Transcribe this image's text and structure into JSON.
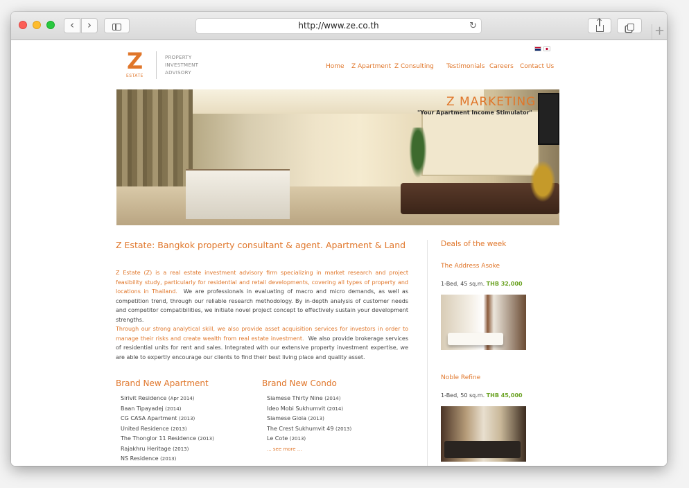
{
  "browser": {
    "url": "http://www.ze.co.th"
  },
  "logo": {
    "letter": "Z",
    "wordmark": "ESTATE",
    "tagline": [
      "PROPERTY",
      "INVESTMENT",
      "ADVISORY"
    ]
  },
  "nav": [
    "Home",
    "Z Apartment",
    "Z Consulting",
    "Testimonials",
    "Careers",
    "Contact Us"
  ],
  "hero": {
    "title": "Z MARKETING",
    "subtitle": "\"Your Apartment Income Stimulator\""
  },
  "main": {
    "heading": "Z Estate: Bangkok property consultant & agent. Apartment & Land",
    "para1_highlight": "Z Estate (Z) is a real estate investment advisory firm specializing in market research and project feasibility study, particularly for residential and retail developments, covering all types of property and locations in Thailand.",
    "para1_rest": "We are professionals in evaluating of macro and micro demands, as well as competition trend, through our reliable research methodology.  By in-depth analysis of customer needs and competitor compatibilities, we initiate novel project concept to effectively sustain your development strengths.",
    "para2_highlight": "Through our strong analytical skill, we also provide asset acquisition services for investors in order to manage their risks and create wealth from real estate investment.",
    "para2_rest": "We also provide brokerage services of residential units for rent and sales. Integrated with our extensive property investment expertise, we are able to expertly encourage our clients to find their best living place and quality asset."
  },
  "apartments": {
    "title": "Brand New Apartment",
    "items": [
      {
        "name": "Sirivit Residence",
        "year": "(Apr 2014)"
      },
      {
        "name": "Baan Tipayadej",
        "year": "(2014)"
      },
      {
        "name": "CG CASA Apartment",
        "year": "(2013)"
      },
      {
        "name": "United Residence",
        "year": "(2013)"
      },
      {
        "name": "The Thonglor 11 Residence",
        "year": "(2013)"
      },
      {
        "name": "Rajakhru Heritage",
        "year": "(2013)"
      },
      {
        "name": "NS Residence",
        "year": "(2013)"
      }
    ]
  },
  "condos": {
    "title": "Brand New Condo",
    "items": [
      {
        "name": "Siamese Thirty Nine",
        "year": "(2014)"
      },
      {
        "name": "Ideo Mobi Sukhumvit",
        "year": "(2014)"
      },
      {
        "name": "Siamese Gioia",
        "year": "(2013)"
      },
      {
        "name": "The Crest Sukhumvit 49",
        "year": "(2013)"
      },
      {
        "name": "Le Cote",
        "year": "(2013)"
      }
    ],
    "see_more": "... see more ..."
  },
  "deals": {
    "title": "Deals of the week",
    "items": [
      {
        "name": "The Address Asoke",
        "info": "1-Bed, 45 sq.m.",
        "price": "THB 32,000"
      },
      {
        "name": "Noble Refine",
        "info": "1-Bed, 50 sq.m.",
        "price": "THB 45,000"
      }
    ]
  },
  "colors": {
    "accent": "#e0762a",
    "price": "#6aa222"
  }
}
